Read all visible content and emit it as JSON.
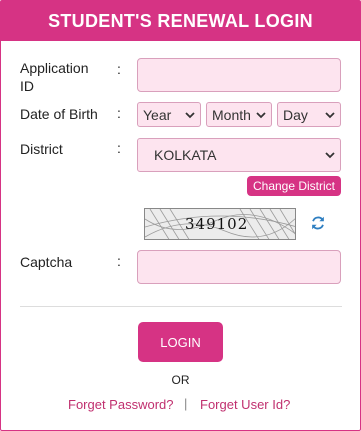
{
  "header": {
    "title": "STUDENT'S RENEWAL LOGIN"
  },
  "form": {
    "application_id": {
      "label_line1": "Application",
      "label_line2": "ID",
      "colon": ":",
      "value": ""
    },
    "dob": {
      "label": "Date of Birth",
      "colon": ":",
      "year": "Year",
      "month": "Month",
      "day": "Day"
    },
    "district": {
      "label": "District",
      "colon": ":",
      "selected": "KOLKATA"
    },
    "change_district_label": "Change District",
    "captcha": {
      "label": "Captcha",
      "colon": ":",
      "image_text": "349102",
      "value": ""
    }
  },
  "actions": {
    "login_label": "LOGIN",
    "or_text": "OR",
    "forget_password": "Forget Password?",
    "separator": "|",
    "forget_user_id": "Forget User Id?"
  },
  "colors": {
    "brand": "#d63384",
    "field_bg": "#fde4ef",
    "link": "#c0306f"
  },
  "icons": {
    "refresh": "refresh-icon",
    "chevron": "chevron-down-icon"
  }
}
